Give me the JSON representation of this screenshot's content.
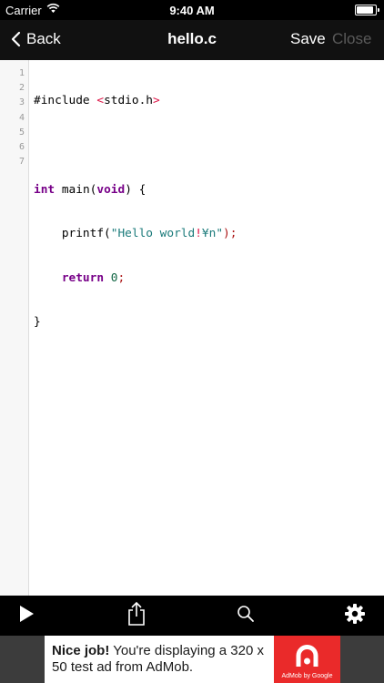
{
  "status_bar": {
    "carrier": "Carrier",
    "time": "9:40 AM",
    "battery_level": 1.0
  },
  "nav": {
    "back_label": "Back",
    "title": "hello.c",
    "save_label": "Save",
    "close_label": "Close"
  },
  "editor": {
    "line_numbers": [
      "1",
      "2",
      "3",
      "4",
      "5",
      "6",
      "7"
    ],
    "code": {
      "line1_prefix": "#include ",
      "line1_lt": "<",
      "line1_header": "stdio.h",
      "line1_gt": ">",
      "line3_int": "int",
      "line3_main": " main(",
      "line3_void": "void",
      "line3_rest": ") {",
      "line4_printf": "    printf(",
      "line4_str1": "\"Hello world",
      "line4_bang": "!",
      "line4_str2": "¥n\"",
      "line4_end": ");",
      "line5_return": "    return",
      "line5_zero": " 0",
      "line5_semi": ";",
      "line6_brace": "}"
    }
  },
  "toolbar": {
    "items": [
      {
        "icon": "play-icon"
      },
      {
        "icon": "share-icon"
      },
      {
        "icon": "search-icon"
      },
      {
        "icon": "gear-icon"
      }
    ]
  },
  "ad": {
    "headline": "Nice job!",
    "body": " You're displaying a 320 x 50 test ad from AdMob.",
    "logo_caption": "AdMob by Google",
    "brand_color": "#ea2a2a"
  }
}
